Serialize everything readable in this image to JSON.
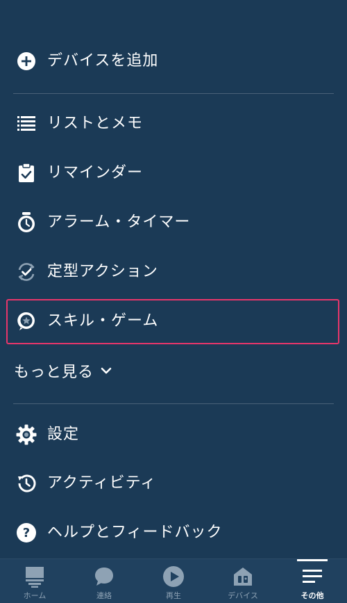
{
  "menu": {
    "add_device": {
      "label": "デバイスを追加",
      "icon": "plus-circle-icon"
    },
    "items_group1": [
      {
        "label": "リストとメモ",
        "icon": "list-icon"
      },
      {
        "label": "リマインダー",
        "icon": "clipboard-check-icon"
      },
      {
        "label": "アラーム・タイマー",
        "icon": "alarm-clock-icon"
      },
      {
        "label": "定型アクション",
        "icon": "routine-check-icon"
      },
      {
        "label": "スキル・ゲーム",
        "icon": "skill-star-bubble-icon"
      }
    ],
    "more": {
      "label": "もっと見る",
      "icon": "chevron-down-icon"
    },
    "items_group2": [
      {
        "label": "設定",
        "icon": "gear-icon"
      },
      {
        "label": "アクティビティ",
        "icon": "history-icon"
      },
      {
        "label": "ヘルプとフィードバック",
        "icon": "help-icon"
      }
    ]
  },
  "tabbar": {
    "tabs": [
      {
        "label": "ホーム",
        "icon": "home-icon"
      },
      {
        "label": "連絡",
        "icon": "chat-bubble-icon"
      },
      {
        "label": "再生",
        "icon": "play-icon"
      },
      {
        "label": "デバイス",
        "icon": "devices-icon"
      },
      {
        "label": "その他",
        "icon": "more-menu-icon"
      }
    ],
    "active": "その他"
  },
  "colors": {
    "background": "#1b3a56",
    "tabbar": "#20415f",
    "highlight": "#e8366b",
    "inactive_tab": "#8ea2b4",
    "text": "#ffffff"
  }
}
